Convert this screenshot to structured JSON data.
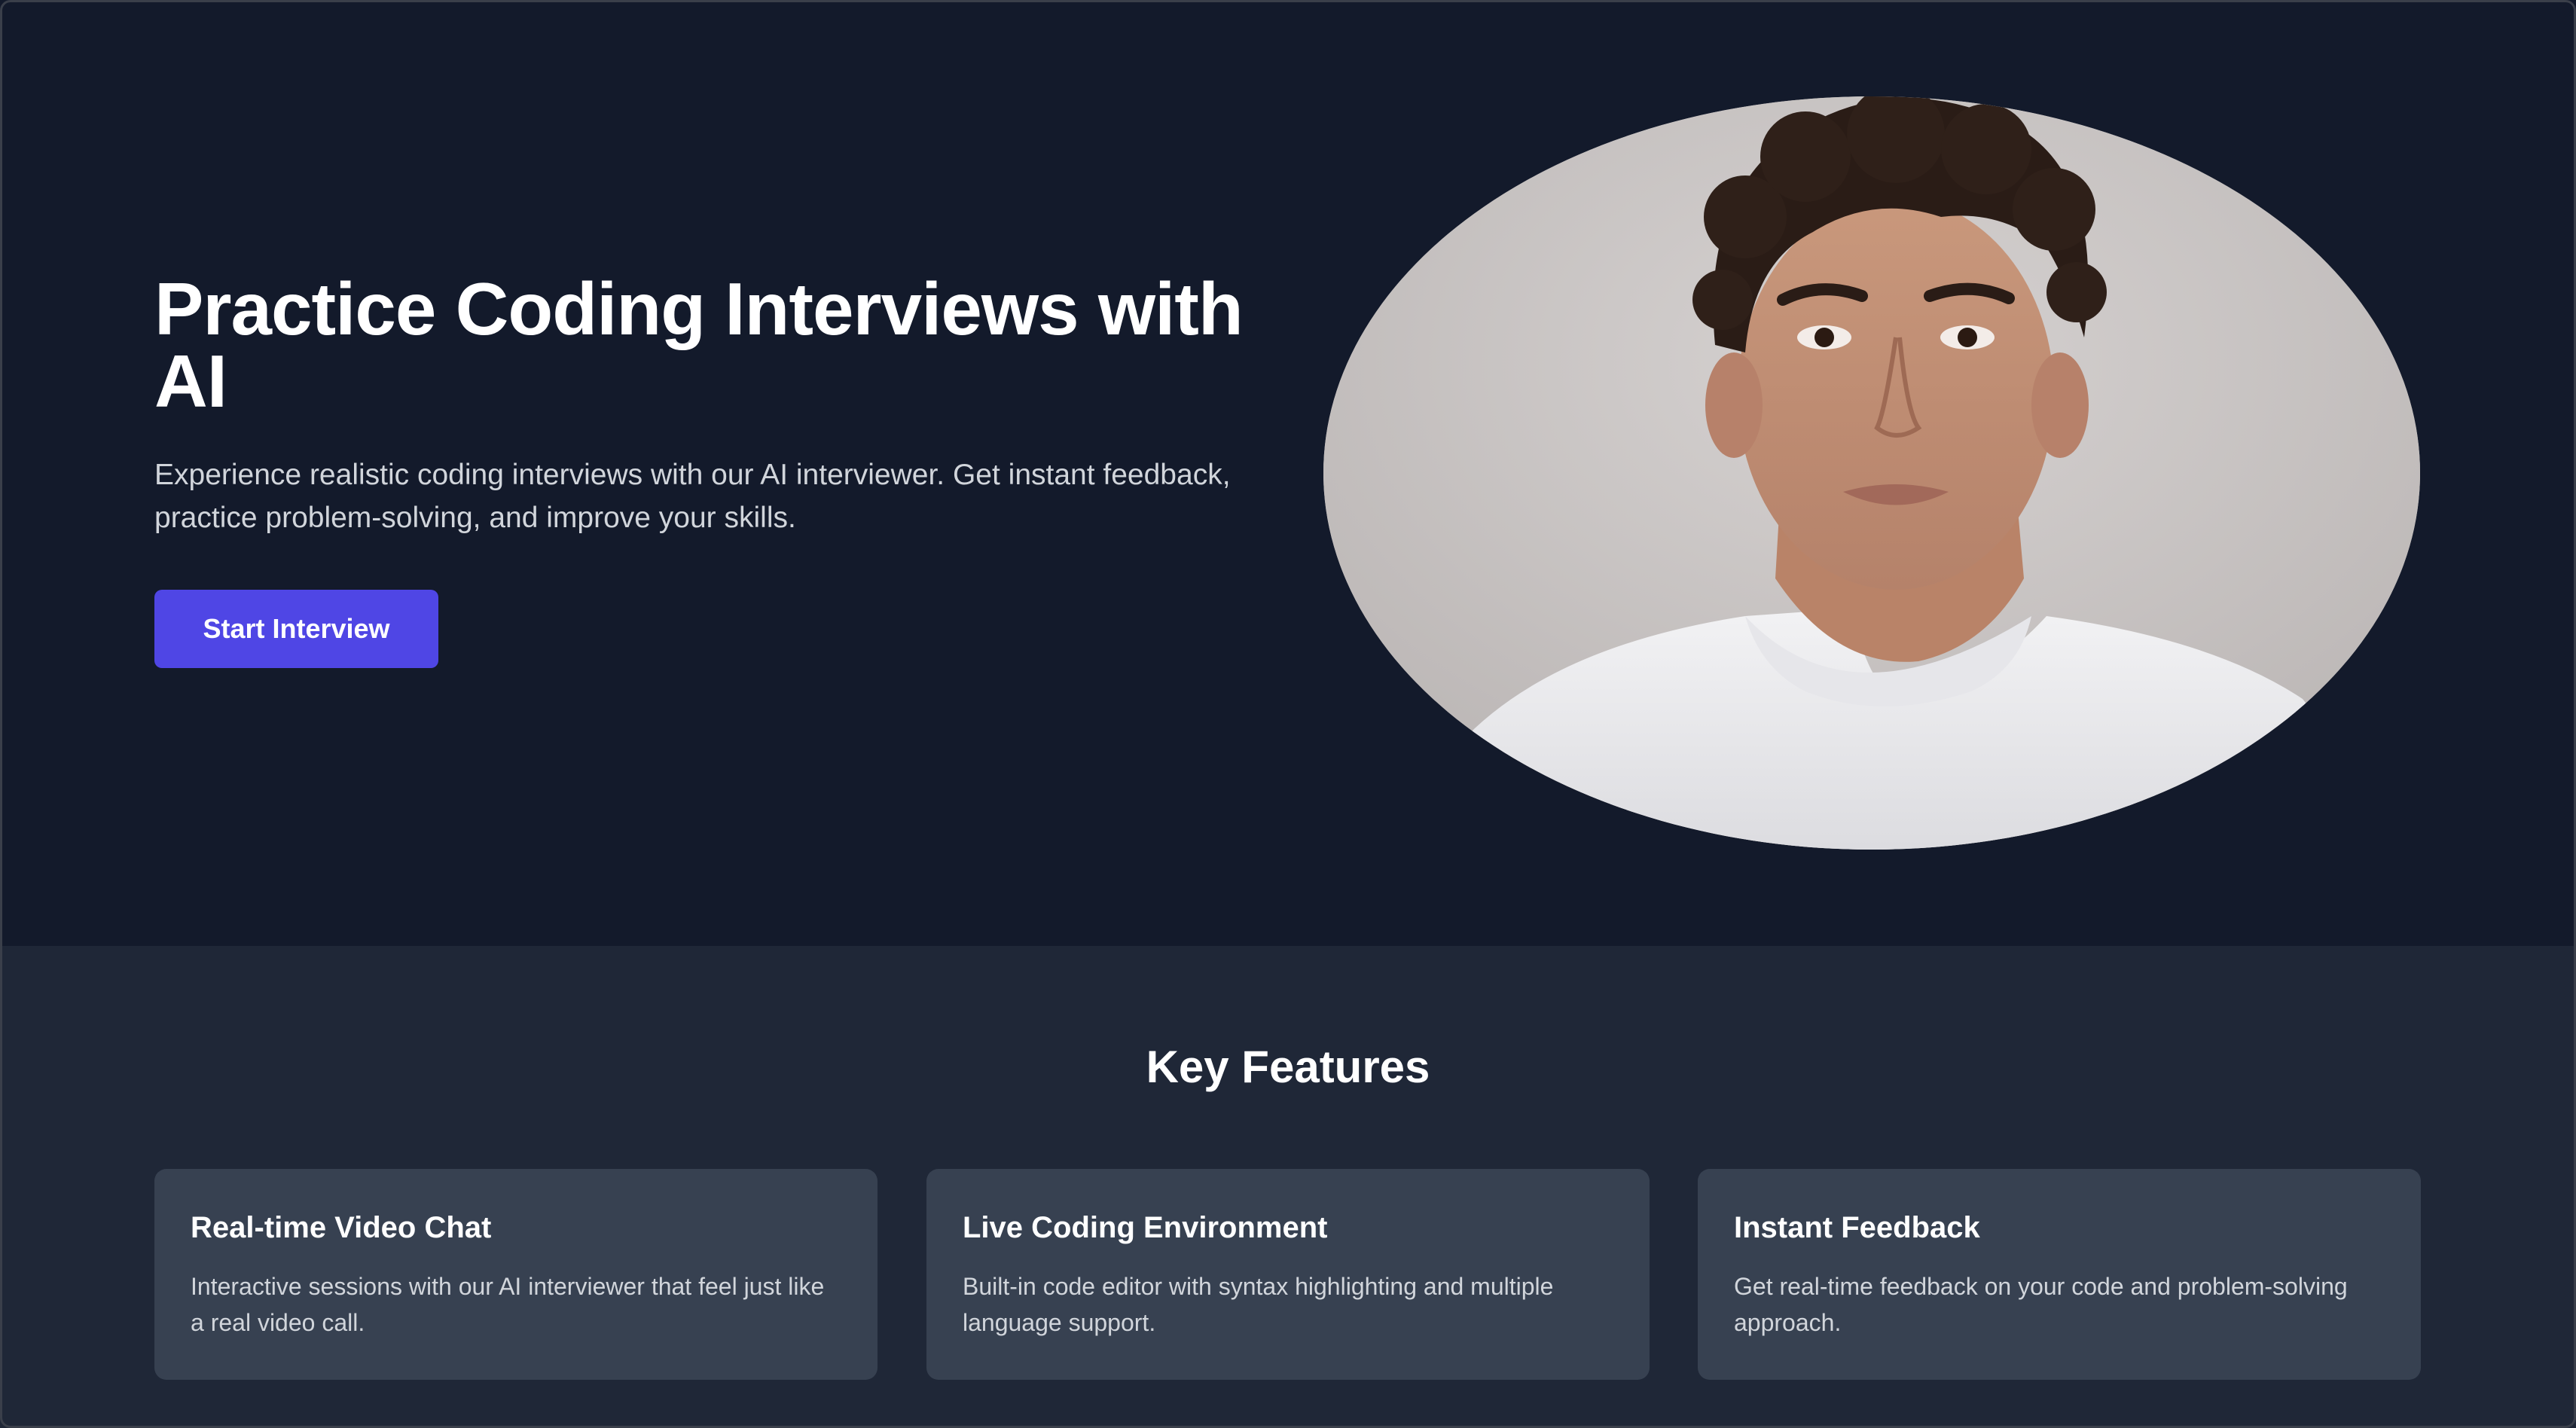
{
  "hero": {
    "title": "Practice Coding Interviews with AI",
    "description": "Experience realistic coding interviews with our AI interviewer. Get instant feedback, practice problem-solving, and improve your skills.",
    "cta_label": "Start Interview"
  },
  "features": {
    "heading": "Key Features",
    "items": [
      {
        "title": "Real-time Video Chat",
        "description": "Interactive sessions with our AI interviewer that feel just like a real video call."
      },
      {
        "title": "Live Coding Environment",
        "description": "Built-in code editor with syntax highlighting and multiple language support."
      },
      {
        "title": "Instant Feedback",
        "description": "Get real-time feedback on your code and problem-solving approach."
      }
    ]
  },
  "colors": {
    "hero_background": "#131a2b",
    "features_background": "#1f2737",
    "card_background": "#374151",
    "accent": "#4f46e5"
  }
}
